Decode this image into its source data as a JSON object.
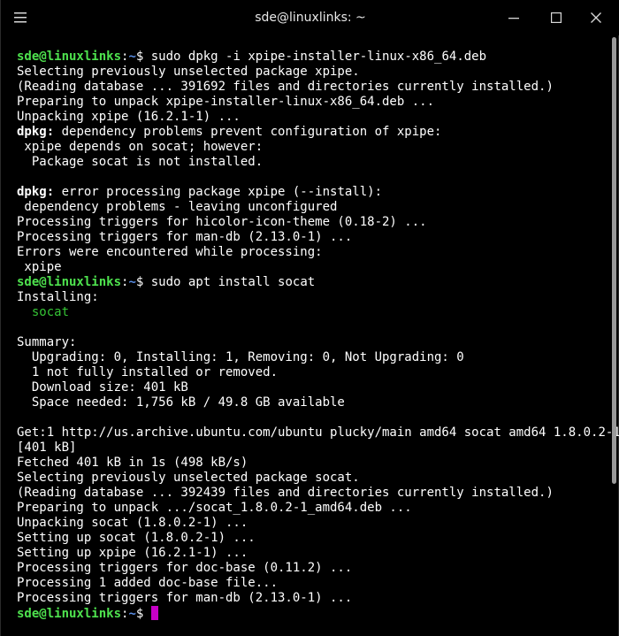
{
  "window": {
    "title": "sde@linuxlinks: ~"
  },
  "icons": {
    "menu": "hamburger-menu-icon",
    "minimize": "minimize-icon",
    "maximize": "maximize-icon",
    "close": "close-icon"
  },
  "colors": {
    "prompt_user": "#4ee24e",
    "prompt_path": "#5a8ee6",
    "package": "#35c435",
    "cursor": "#c800c8",
    "background": "#000000"
  },
  "terminal": {
    "prompt_user": "sde@linuxlinks",
    "prompt_path": "~",
    "lines": [
      {
        "type": "cmd",
        "text": "sudo dpkg -i xpipe-installer-linux-x86_64.deb"
      },
      {
        "type": "out",
        "text": "Selecting previously unselected package xpipe."
      },
      {
        "type": "out",
        "text": "(Reading database ... 391692 files and directories currently installed.)"
      },
      {
        "type": "out",
        "text": "Preparing to unpack xpipe-installer-linux-x86_64.deb ..."
      },
      {
        "type": "out",
        "text": "Unpacking xpipe (16.2.1-1) ..."
      },
      {
        "type": "boldprefix",
        "prefix": "dpkg:",
        "text": " dependency problems prevent configuration of xpipe:"
      },
      {
        "type": "out",
        "text": " xpipe depends on socat; however:"
      },
      {
        "type": "out",
        "text": "  Package socat is not installed."
      },
      {
        "type": "blank",
        "text": ""
      },
      {
        "type": "boldprefix",
        "prefix": "dpkg:",
        "text": " error processing package xpipe (--install):"
      },
      {
        "type": "out",
        "text": " dependency problems - leaving unconfigured"
      },
      {
        "type": "out",
        "text": "Processing triggers for hicolor-icon-theme (0.18-2) ..."
      },
      {
        "type": "out",
        "text": "Processing triggers for man-db (2.13.0-1) ..."
      },
      {
        "type": "out",
        "text": "Errors were encountered while processing:"
      },
      {
        "type": "out",
        "text": " xpipe"
      },
      {
        "type": "cmd",
        "text": "sudo apt install socat"
      },
      {
        "type": "out",
        "text": "Installing:"
      },
      {
        "type": "green",
        "text": "  socat"
      },
      {
        "type": "blank",
        "text": ""
      },
      {
        "type": "out",
        "text": "Summary:"
      },
      {
        "type": "out",
        "text": "  Upgrading: 0, Installing: 1, Removing: 0, Not Upgrading: 0"
      },
      {
        "type": "out",
        "text": "  1 not fully installed or removed."
      },
      {
        "type": "out",
        "text": "  Download size: 401 kB"
      },
      {
        "type": "out",
        "text": "  Space needed: 1,756 kB / 49.8 GB available"
      },
      {
        "type": "blank",
        "text": ""
      },
      {
        "type": "out",
        "text": "Get:1 http://us.archive.ubuntu.com/ubuntu plucky/main amd64 socat amd64 1.8.0.2-1"
      },
      {
        "type": "out",
        "text": "[401 kB]"
      },
      {
        "type": "out",
        "text": "Fetched 401 kB in 1s (498 kB/s)"
      },
      {
        "type": "out",
        "text": "Selecting previously unselected package socat."
      },
      {
        "type": "out",
        "text": "(Reading database ... 392439 files and directories currently installed.)"
      },
      {
        "type": "out",
        "text": "Preparing to unpack .../socat_1.8.0.2-1_amd64.deb ..."
      },
      {
        "type": "out",
        "text": "Unpacking socat (1.8.0.2-1) ..."
      },
      {
        "type": "out",
        "text": "Setting up socat (1.8.0.2-1) ..."
      },
      {
        "type": "out",
        "text": "Setting up xpipe (16.2.1-1) ..."
      },
      {
        "type": "out",
        "text": "Processing triggers for doc-base (0.11.2) ..."
      },
      {
        "type": "out",
        "text": "Processing 1 added doc-base file..."
      },
      {
        "type": "out",
        "text": "Processing triggers for man-db (2.13.0-1) ..."
      },
      {
        "type": "prompt",
        "text": ""
      }
    ]
  }
}
